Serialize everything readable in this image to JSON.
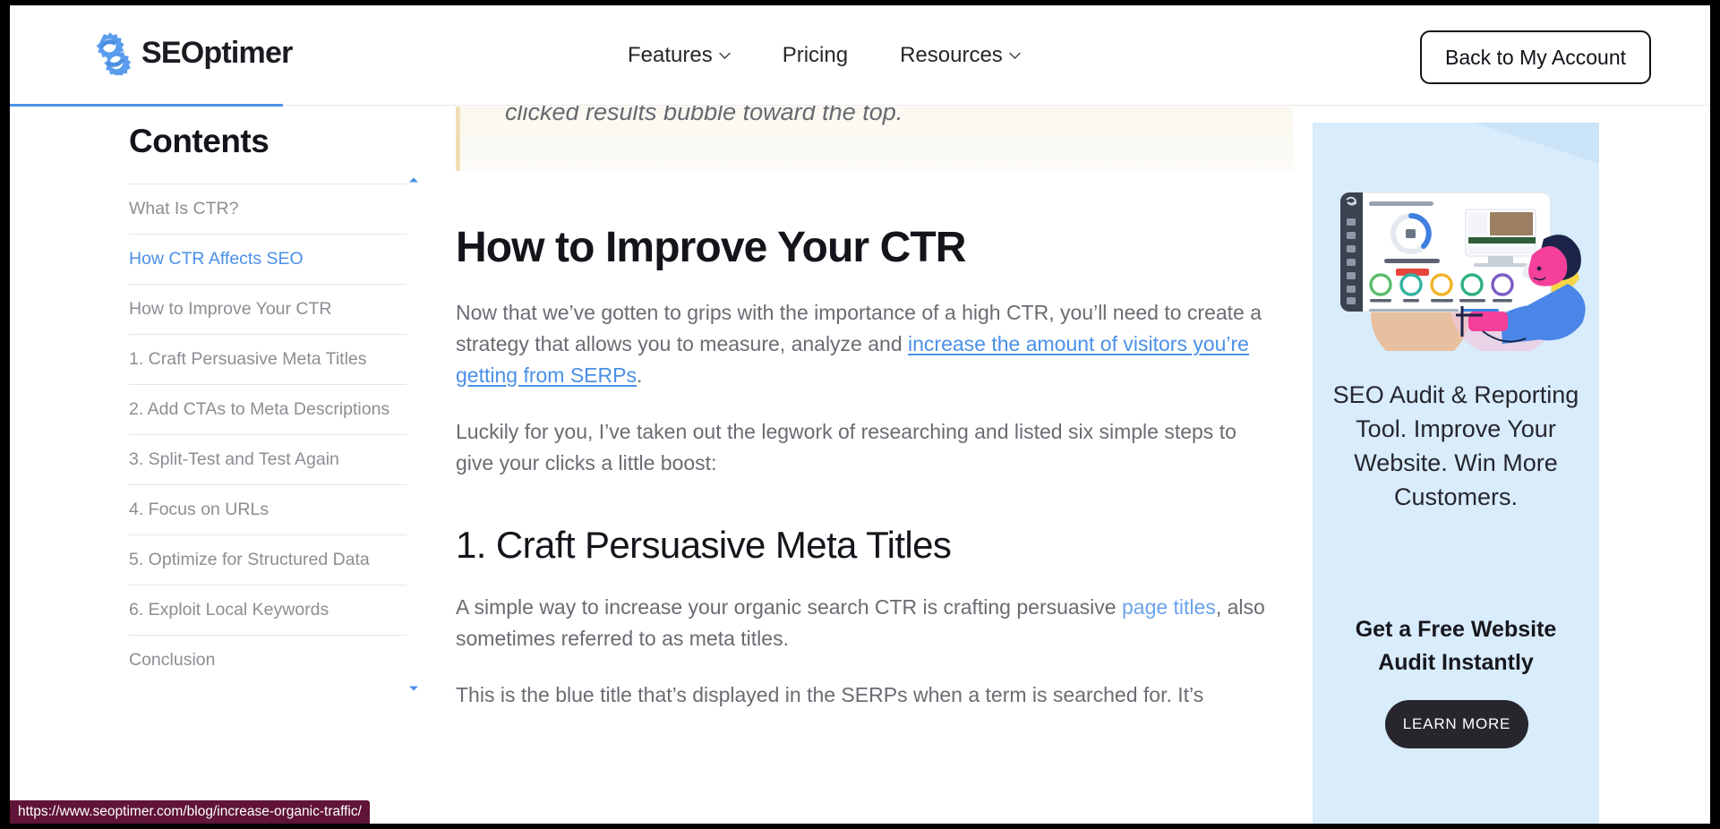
{
  "header": {
    "logo_text": "SEOptimer",
    "logo_icon": "seoptimer-gear-logo",
    "nav": [
      {
        "label": "Features",
        "has_dropdown": true,
        "icon": "chevron-down-icon"
      },
      {
        "label": "Pricing",
        "has_dropdown": false,
        "icon": ""
      },
      {
        "label": "Resources",
        "has_dropdown": true,
        "icon": "chevron-down-icon"
      }
    ],
    "account_button": "Back to My Account",
    "progress_percent": 16,
    "accent_color": "#4a90e8"
  },
  "toc": {
    "title": "Contents",
    "scroll_up_icon": "caret-up-icon",
    "scroll_down_icon": "caret-down-icon",
    "items": [
      {
        "label": "What Is CTR?",
        "active": false
      },
      {
        "label": "How CTR Affects SEO",
        "active": true
      },
      {
        "label": "How to Improve Your CTR",
        "active": false
      },
      {
        "label": "1. Craft Persuasive Meta Titles",
        "active": false
      },
      {
        "label": "2. Add CTAs to Meta Descriptions",
        "active": false
      },
      {
        "label": "3. Split-Test and Test Again",
        "active": false
      },
      {
        "label": "4. Focus on URLs",
        "active": false
      },
      {
        "label": "5. Optimize for Structured Data",
        "active": false
      },
      {
        "label": "6. Exploit Local Keywords",
        "active": false
      },
      {
        "label": "Conclusion",
        "active": false
      }
    ]
  },
  "article": {
    "quote_tail": "clicked results bubble toward the top.",
    "heading_h2": "How to Improve Your CTR",
    "para1_part1": "Now that we’ve gotten to grips with the importance of a high CTR, you’ll need to create a strategy that allows you to measure, analyze and ",
    "para1_link": "increase the amount of visitors you’re getting from SERPs",
    "para1_part2": ".",
    "para2": "Luckily for you, I’ve taken out the legwork of researching and listed six simple steps to give your clicks a little boost:",
    "heading_h3": "1. Craft Persuasive Meta Titles",
    "para3_part1": "A simple way to increase your organic search CTR is crafting persuasive ",
    "para3_link": "page titles",
    "para3_part2": ", also sometimes referred to as meta titles.",
    "para4": "This is the blue title that’s displayed in the SERPs when a term is searched for. It’s"
  },
  "ad": {
    "illustration": "seo-audit-dashboard-illustration",
    "headline": "SEO Audit & Reporting Tool. Improve Your Website. Win More Customers.",
    "subhead": "Get a Free Website Audit Instantly",
    "cta_label": "LEARN MORE",
    "background_color": "#d8ecfb",
    "cta_background": "#26262c"
  },
  "status_bar": {
    "url": "https://www.seoptimer.com/blog/increase-organic-traffic/"
  }
}
